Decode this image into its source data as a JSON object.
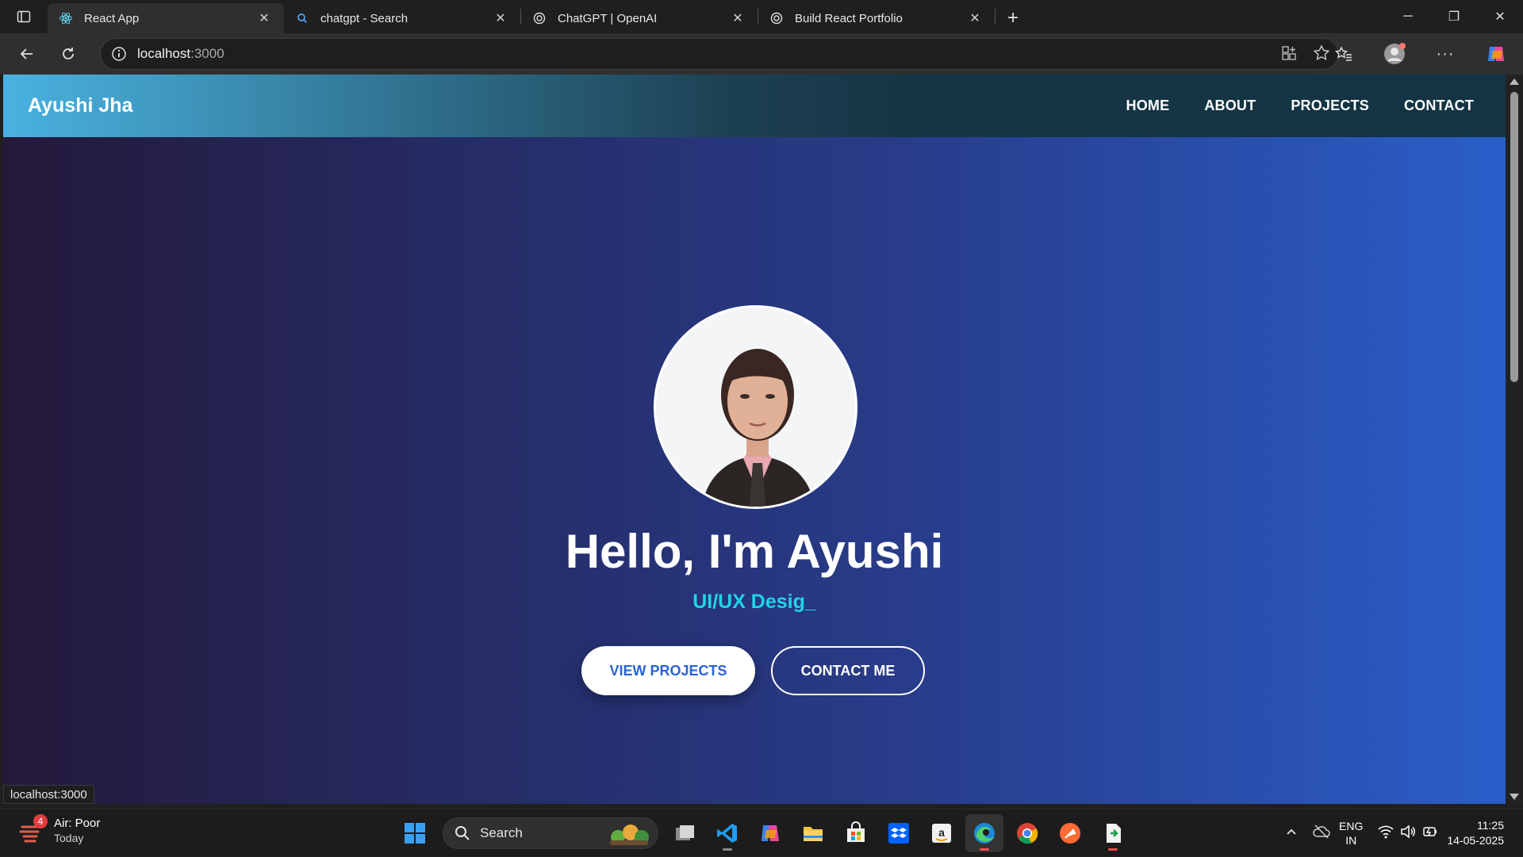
{
  "browser": {
    "tabs": [
      {
        "title": "React App",
        "favicon": "react-icon",
        "active": true
      },
      {
        "title": "chatgpt - Search",
        "favicon": "search-icon",
        "active": false
      },
      {
        "title": "ChatGPT | OpenAI",
        "favicon": "openai-icon",
        "active": false
      },
      {
        "title": "Build React Portfolio",
        "favicon": "openai-icon",
        "active": false
      }
    ],
    "address": {
      "host": "localhost",
      "port": ":3000"
    },
    "status_link": "localhost:3000"
  },
  "page": {
    "brand": "Ayushi Jha",
    "nav": [
      {
        "label": "HOME"
      },
      {
        "label": "ABOUT"
      },
      {
        "label": "PROJECTS"
      },
      {
        "label": "CONTACT"
      }
    ],
    "headline": "Hello, I'm Ayushi",
    "role_typing": "UI/UX Desig",
    "cursor": "_",
    "buttons": {
      "primary": "VIEW PROJECTS",
      "secondary": "CONTACT ME"
    },
    "colors": {
      "accent_text": "#20d4e8",
      "primary_button_text": "#2a63d3"
    }
  },
  "taskbar": {
    "weather": {
      "title": "Air: Poor",
      "subtitle": "Today",
      "badge": "4"
    },
    "search_placeholder": "Search",
    "apps": [
      "windows-start-icon",
      "task-view-icon",
      "vscode-icon",
      "copilot-icon",
      "file-explorer-icon",
      "store-icon",
      "dropbox-icon",
      "amazon-icon",
      "edge-icon",
      "chrome-icon",
      "postman-icon",
      "app-icon"
    ],
    "lang": {
      "line1": "ENG",
      "line2": "IN"
    },
    "clock": {
      "time": "11:25",
      "date": "14-05-2025"
    }
  }
}
